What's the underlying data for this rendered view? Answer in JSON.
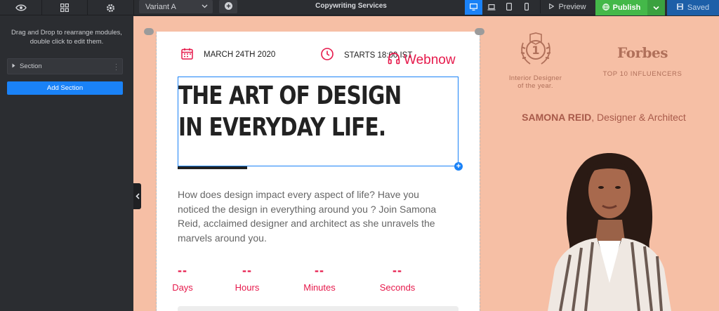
{
  "toolbar": {
    "tabs": [
      {
        "icon": "eye-icon"
      },
      {
        "icon": "grid-icon"
      },
      {
        "icon": "gear-icon"
      }
    ],
    "variant": "Variant A",
    "title": "Copywriting Services",
    "devices": [
      {
        "icon": "desktop-icon",
        "active": true
      },
      {
        "icon": "laptop-icon",
        "active": false
      },
      {
        "icon": "tablet-icon",
        "active": false
      },
      {
        "icon": "mobile-icon",
        "active": false
      }
    ],
    "preview_label": "Preview",
    "publish_label": "Publish",
    "saved_label": "Saved"
  },
  "sidebar": {
    "hint": "Drag and Drop to rearrange modules, double click to edit them.",
    "section_label": "Section",
    "add_section_label": "Add Section"
  },
  "page": {
    "date": "MARCH 24TH 2020",
    "time": "STARTS 18:00 IST",
    "brand": "Webnow",
    "headline_line1": "THE ART OF DESIGN",
    "headline_line2": "IN EVERYDAY LIFE.",
    "body": "How does design impact every aspect of life? Have you noticed the design in everything around you ? Join Samona Reid, acclaimed designer and architect as she unravels the marvels around you.",
    "countdown": [
      {
        "value": "--",
        "unit": "Days"
      },
      {
        "value": "--",
        "unit": "Hours"
      },
      {
        "value": "--",
        "unit": "Minutes"
      },
      {
        "value": "--",
        "unit": "Seconds"
      }
    ],
    "award_caption": "Interior Designer of the year.",
    "award_number": "1",
    "forbes_logo": "Forbes",
    "forbes_caption": "TOP 10 INFLUENCERS",
    "person_name": "SAMONA REID",
    "person_role": ", Designer & Architect"
  },
  "colors": {
    "accent": "#1a82f7",
    "brand": "#e6194b",
    "publish": "#44b849",
    "canvas_bg": "#f6bfa5"
  }
}
